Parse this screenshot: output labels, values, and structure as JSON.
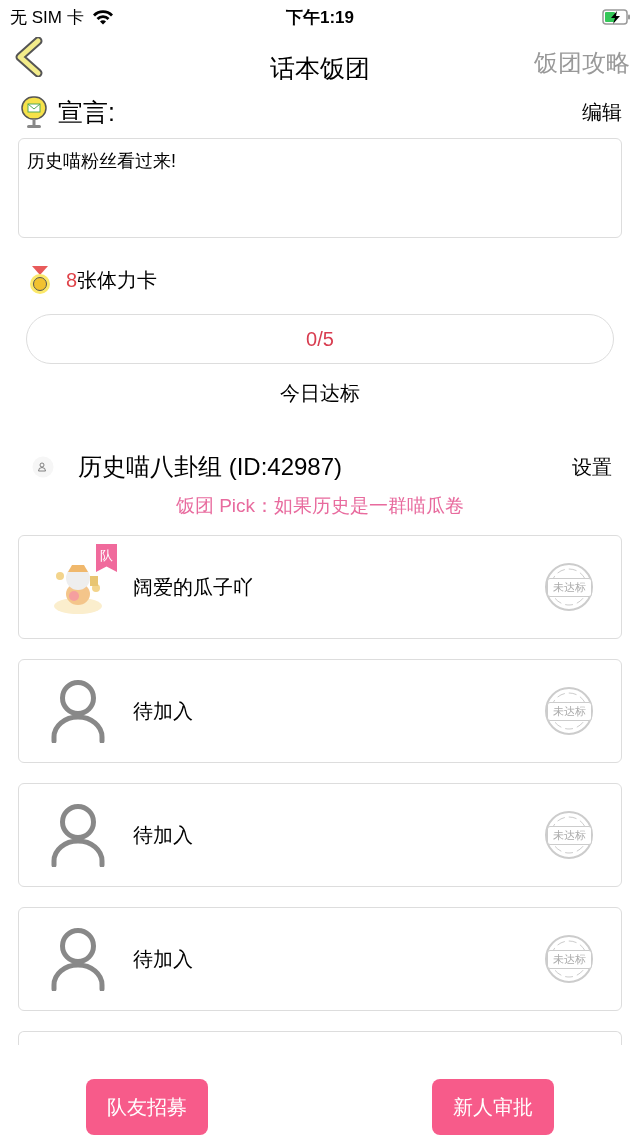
{
  "status_bar": {
    "carrier": "无 SIM 卡",
    "time": "下午1:19",
    "battery_charging": true
  },
  "nav": {
    "title": "话本饭团",
    "action": "饭团攻略"
  },
  "declaration": {
    "label": "宣言:",
    "edit": "编辑",
    "value": "历史喵粉丝看过来!"
  },
  "cards": {
    "count": "8",
    "unit": "张体力卡"
  },
  "progress": {
    "reading": "0/5",
    "level": 0,
    "caption": "今日达标"
  },
  "group": {
    "name": "历史喵八卦组 (ID:42987)",
    "settings": "设置",
    "pick": "饭团 Pick：如果历史是一群喵瓜卷"
  },
  "members": [
    {
      "kind": "avatar",
      "name": "阔爱的瓜子吖",
      "badge": "队",
      "stamp": "未达标"
    },
    {
      "kind": "placeholder",
      "name": "待加入",
      "stamp": "未达标"
    },
    {
      "kind": "placeholder",
      "name": "待加入",
      "stamp": "未达标"
    },
    {
      "kind": "placeholder",
      "name": "待加入",
      "stamp": "未达标"
    }
  ],
  "buttons": [
    "队友招募",
    "新人审批"
  ]
}
